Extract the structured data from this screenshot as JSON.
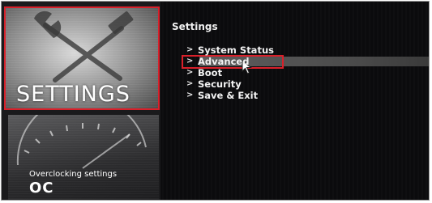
{
  "left_tiles": {
    "settings": {
      "label": "SETTINGS",
      "icon": "wrench-hammer-icon",
      "highlighted": true,
      "highlight_color": "#d8202a"
    },
    "oc": {
      "subtitle": "Overclocking settings",
      "label": "OC",
      "icon": "speedometer-gauge-icon"
    }
  },
  "panel": {
    "title": "Settings",
    "items": [
      {
        "label": "System Status"
      },
      {
        "label": "Advanced",
        "selected": true
      },
      {
        "label": "Boot"
      },
      {
        "label": "Security"
      },
      {
        "label": "Save & Exit"
      }
    ],
    "chevron": ">"
  },
  "colors": {
    "accent": "#d8202a",
    "background": "#0b0b0d",
    "text": "#f2f2f2"
  }
}
